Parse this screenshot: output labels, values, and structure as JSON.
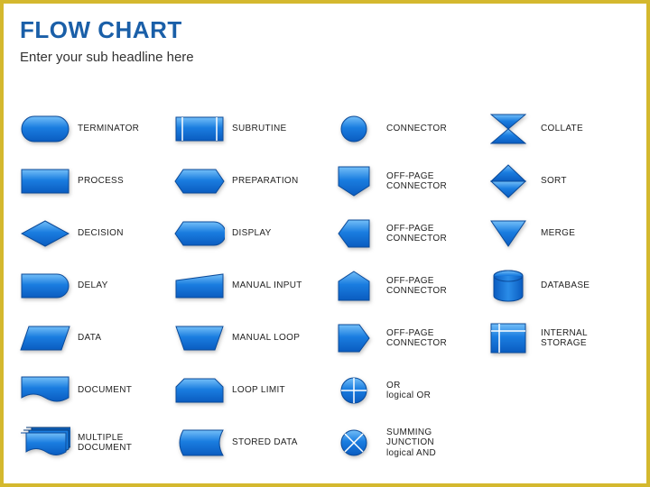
{
  "header": {
    "title": "FLOW CHART",
    "subtitle": "Enter your sub headline here"
  },
  "columns": [
    [
      "TERMINATOR",
      "PROCESS",
      "DECISION",
      "DELAY",
      "DATA",
      "DOCUMENT",
      "MULTIPLE\nDOCUMENT"
    ],
    [
      "SUBRUTINE",
      "PREPARATION",
      "DISPLAY",
      "MANUAL INPUT",
      "MANUAL LOOP",
      "LOOP LIMIT",
      "STORED DATA"
    ],
    [
      "CONNECTOR",
      "OFF-PAGE CONNECTOR",
      "OFF-PAGE CONNECTOR",
      "OFF-PAGE CONNECTOR",
      "OFF-PAGE CONNECTOR",
      "OR\nlogical OR",
      "SUMMING JUNCTION\nlogical AND"
    ],
    [
      "COLLATE",
      "SORT",
      "MERGE",
      "DATABASE",
      "INTERNAL STORAGE"
    ]
  ],
  "icons": [
    [
      "terminator",
      "process",
      "decision",
      "delay",
      "data",
      "document",
      "multidoc"
    ],
    [
      "subroutine",
      "preparation",
      "display",
      "manualinput",
      "manualloop",
      "looplimit",
      "storeddata"
    ],
    [
      "connector",
      "offpage-down",
      "offpage-left",
      "offpage-up",
      "offpage-right",
      "or",
      "sumjunction"
    ],
    [
      "collate",
      "sort",
      "merge",
      "database",
      "internalstorage"
    ]
  ]
}
